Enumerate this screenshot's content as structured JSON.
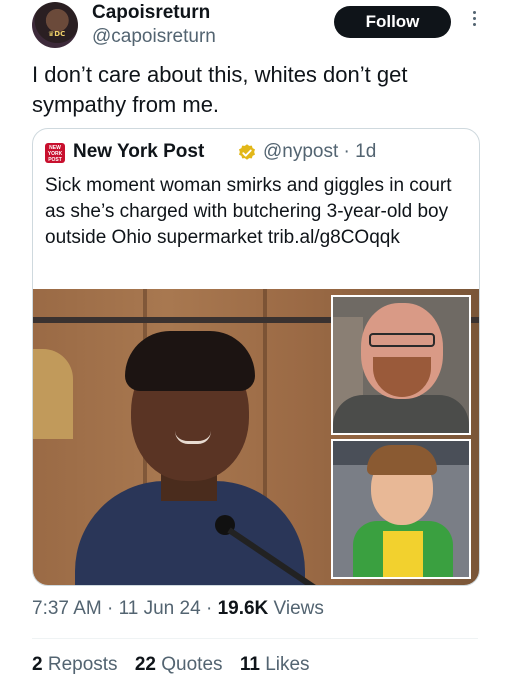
{
  "author": {
    "display_name": "Capoisreturn",
    "handle": "@capoisreturn",
    "follow_label": "Follow",
    "avatar_text": "♛DC"
  },
  "tweet": {
    "text": "I don’t care about this, whites don’t get sympathy from me."
  },
  "quote": {
    "logo_text": "NEW YORK POST",
    "source_name": "New York Post",
    "source_handle": "@nypost · 1d",
    "text": "Sick moment woman smirks and giggles in court as she’s charged with butchering 3-year-old boy outside Ohio supermarket trib.al/g8COqqk",
    "verified_color": "#e2b719"
  },
  "meta": {
    "time": "7:37 AM",
    "sep1": "·",
    "date": "11 Jun 24",
    "sep2": "·",
    "views_count": "19.6K",
    "views_label": "Views"
  },
  "stats": [
    {
      "count": "2",
      "label": "Reposts"
    },
    {
      "count": "22",
      "label": "Quotes"
    },
    {
      "count": "11",
      "label": "Likes"
    }
  ],
  "colors": {
    "text": "#0f1419",
    "secondary": "#536471",
    "border": "#cfd9de"
  },
  "icons": [
    "verified-badge-icon",
    "more-options-icon"
  ]
}
